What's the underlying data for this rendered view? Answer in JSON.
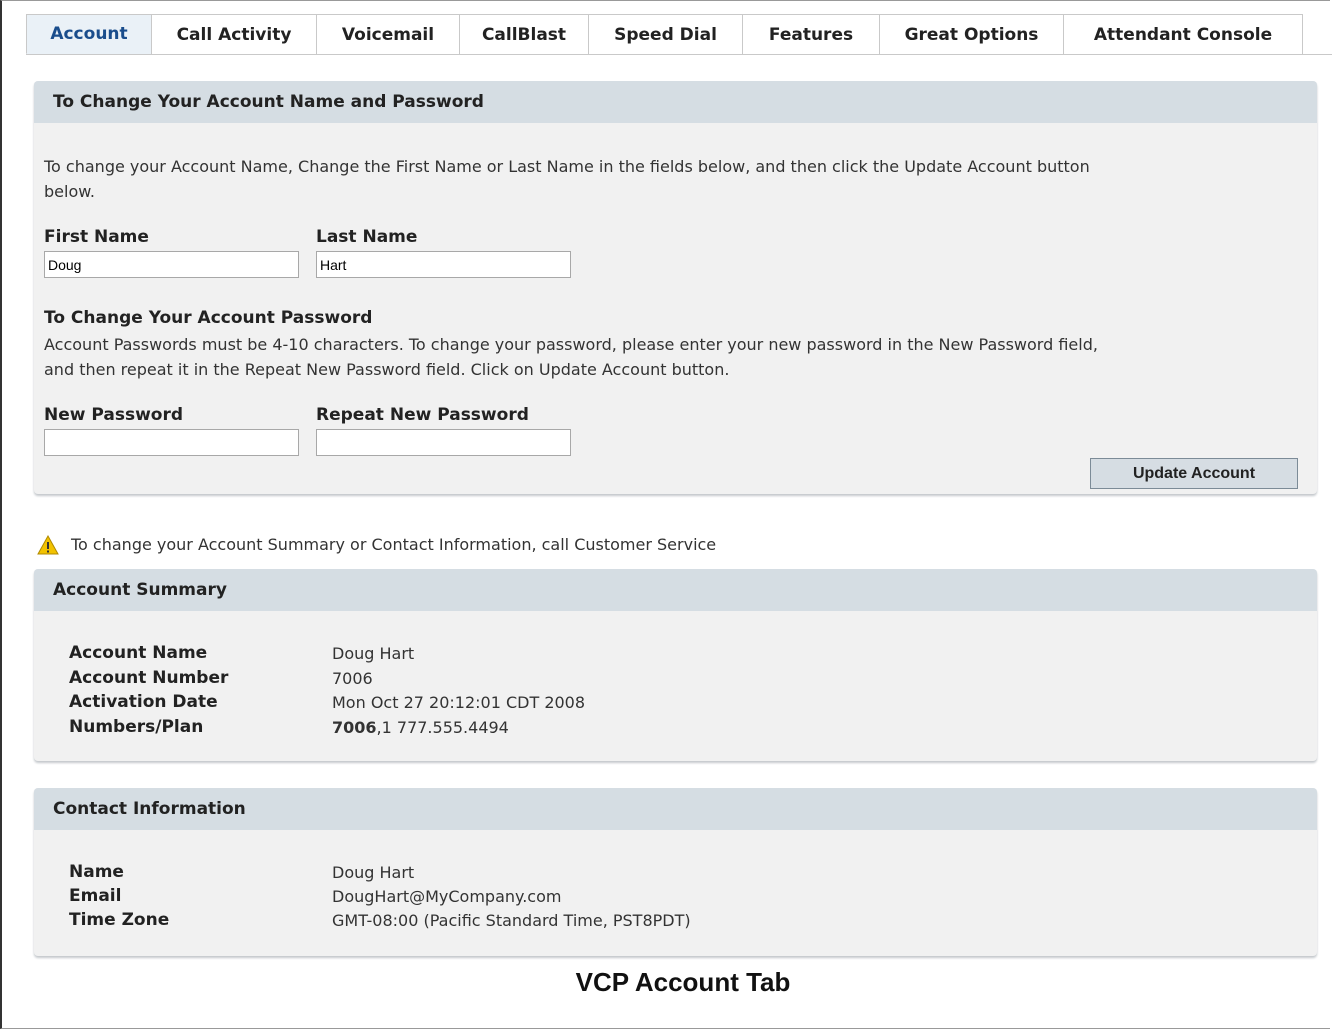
{
  "tabs": [
    {
      "label": "Account"
    },
    {
      "label": "Call Activity"
    },
    {
      "label": "Voicemail"
    },
    {
      "label": "CallBlast"
    },
    {
      "label": "Speed Dial"
    },
    {
      "label": "Features"
    },
    {
      "label": "Great Options"
    },
    {
      "label": "Attendant Console"
    }
  ],
  "change_panel": {
    "title": "To Change Your Account Name and Password",
    "intro_line1": "To change your Account Name, Change the First Name or Last Name in the fields below, and then click the Update Account button",
    "intro_line2": "below.",
    "first_name_label": "First Name",
    "first_name_value": "Doug",
    "last_name_label": "Last Name",
    "last_name_value": "Hart",
    "password_heading": "To Change Your Account Password",
    "password_text_line1": "Account Passwords must be 4-10 characters. To change your password, please enter your new password in the New Password field,",
    "password_text_line2": "and then repeat it in the Repeat New Password field. Click on Update Account button.",
    "new_password_label": "New Password",
    "new_password_value": "",
    "repeat_password_label": "Repeat New Password",
    "repeat_password_value": "",
    "update_button": "Update Account"
  },
  "notice": "To change your Account Summary or Contact Information, call Customer Service",
  "summary": {
    "title": "Account Summary",
    "account_name_label": "Account Name",
    "account_name": "Doug Hart",
    "account_number_label": "Account Number",
    "account_number": "7006",
    "activation_date_label": "Activation Date",
    "activation_date": "Mon Oct 27 20:12:01 CDT 2008",
    "numbers_plan_label": "Numbers/Plan",
    "numbers_plan_primary": "7006",
    "numbers_plan_rest": ",1 777.555.4494"
  },
  "contact": {
    "title": "Contact Information",
    "name_label": "Name",
    "name": "Doug Hart",
    "email_label": "Email",
    "email": "DougHart@MyCompany.com",
    "time_zone_label": "Time Zone",
    "time_zone": "GMT-08:00 (Pacific Standard Time, PST8PDT)"
  },
  "caption": "VCP Account Tab",
  "colors": {
    "active_tab_text": "#1a4d8c",
    "panel_header_bg": "#d5dde3",
    "panel_bg": "#f1f1f1",
    "warning_icon": "#f2c200"
  }
}
